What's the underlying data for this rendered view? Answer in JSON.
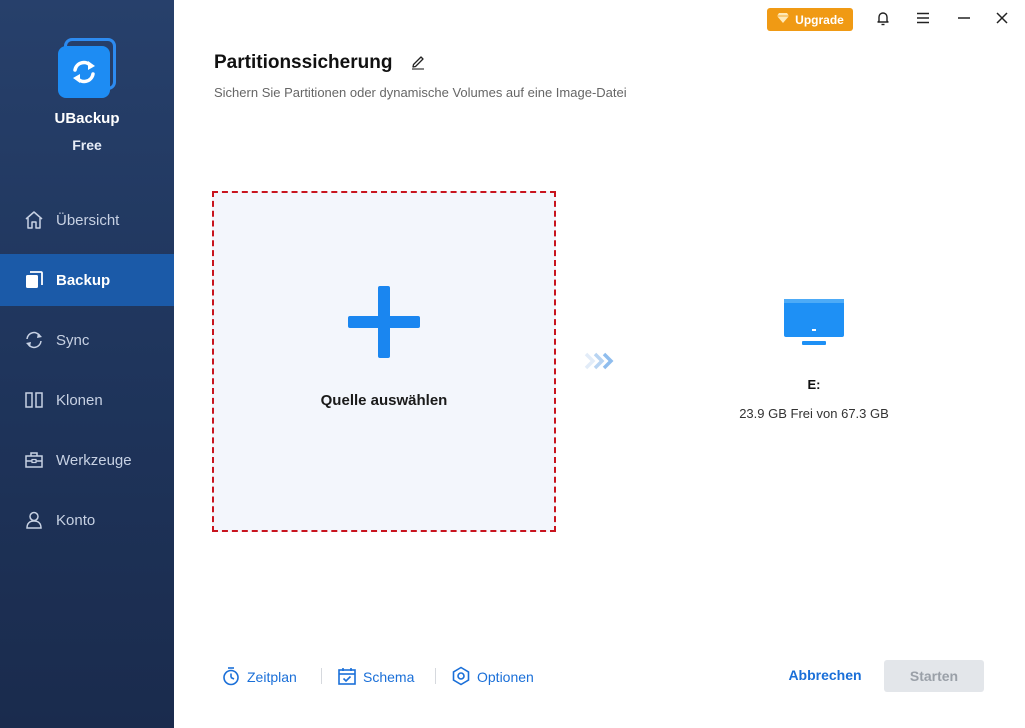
{
  "app": {
    "name": "UBackup",
    "edition": "Free"
  },
  "sidebar": {
    "items": [
      {
        "label": "Übersicht",
        "icon": "home-icon",
        "active": false
      },
      {
        "label": "Backup",
        "icon": "backup-icon",
        "active": true
      },
      {
        "label": "Sync",
        "icon": "sync-icon",
        "active": false
      },
      {
        "label": "Klonen",
        "icon": "clone-icon",
        "active": false
      },
      {
        "label": "Werkzeuge",
        "icon": "toolbox-icon",
        "active": false
      },
      {
        "label": "Konto",
        "icon": "user-icon",
        "active": false
      }
    ]
  },
  "topbar": {
    "upgrade_label": "Upgrade"
  },
  "header": {
    "title": "Partitionssicherung",
    "subtitle": "Sichern Sie Partitionen oder dynamische Volumes auf eine Image-Datei"
  },
  "source": {
    "label": "Quelle auswählen"
  },
  "destination": {
    "name": "E:",
    "space": "23.9 GB Frei von 67.3 GB"
  },
  "footer": {
    "schedule_label": "Zeitplan",
    "scheme_label": "Schema",
    "options_label": "Optionen",
    "cancel_label": "Abbrechen",
    "start_label": "Starten"
  },
  "colors": {
    "sidebar_bg": "#1f355c",
    "active_item": "#1b5aa8",
    "accent_blue": "#1a6fd8",
    "upgrade_orange": "#f09a14",
    "dashed_border": "#c8141e"
  }
}
